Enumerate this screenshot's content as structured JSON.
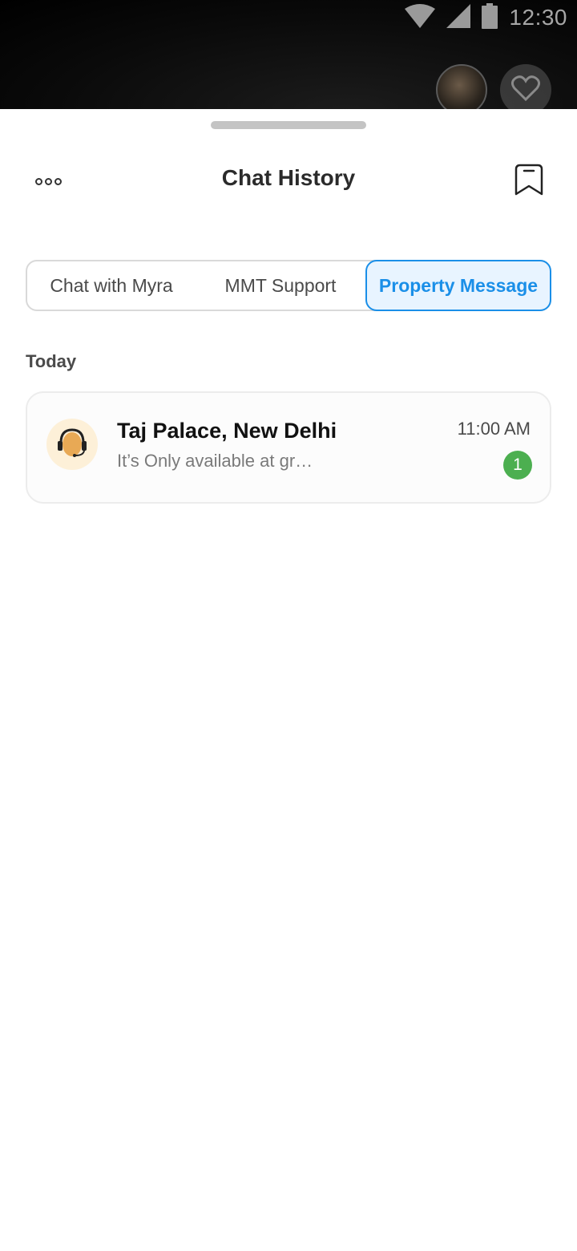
{
  "status_bar": {
    "time": "12:30",
    "icons": [
      "wifi-icon",
      "cellular-signal-icon",
      "battery-icon"
    ]
  },
  "backdrop": {
    "icons": [
      "host-avatar",
      "heart-icon"
    ]
  },
  "header": {
    "title": "Chat History",
    "left_icon": "more-options-icon",
    "right_icon": "bookmark-icon"
  },
  "tabs": [
    {
      "label": "Chat with Myra",
      "selected": false
    },
    {
      "label": "MMT Support",
      "selected": false
    },
    {
      "label": "Property Message",
      "selected": true
    }
  ],
  "sections": [
    {
      "label": "Today",
      "chats": [
        {
          "name": "Taj Palace, New Delhi",
          "preview": "It’s Only available at gr…",
          "time": "11:00 AM",
          "unread": "1",
          "avatar_icon": "support-agent-headset-icon"
        }
      ]
    }
  ],
  "colors": {
    "accent": "#1a8fe8",
    "accent_bg": "#e8f4ff",
    "badge": "#4caf50",
    "avatar_bg": "#fdf0d8"
  }
}
